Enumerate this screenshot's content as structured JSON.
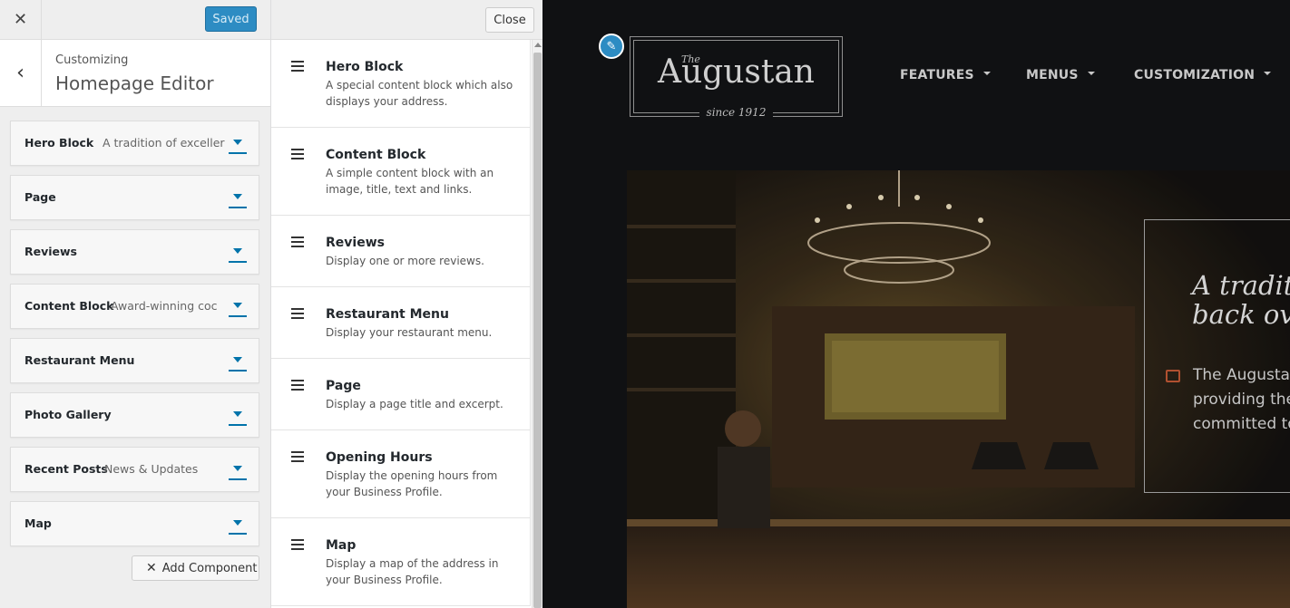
{
  "customizer": {
    "close_icon": "close-icon",
    "saved_label": "Saved",
    "back_icon": "chevron-left-icon",
    "subtitle": "Customizing",
    "title": "Homepage Editor",
    "components": [
      {
        "title": "Hero Block",
        "subtitle": "A tradition of exceller"
      },
      {
        "title": "Page",
        "subtitle": ""
      },
      {
        "title": "Reviews",
        "subtitle": ""
      },
      {
        "title": "Content Block",
        "subtitle": "Award-winning coc"
      },
      {
        "title": "Restaurant Menu",
        "subtitle": ""
      },
      {
        "title": "Photo Gallery",
        "subtitle": ""
      },
      {
        "title": "Recent Posts",
        "subtitle": "News & Updates"
      },
      {
        "title": "Map",
        "subtitle": ""
      }
    ],
    "add_component_label": "Add Component"
  },
  "picker": {
    "close_label": "Close",
    "items": [
      {
        "title": "Hero Block",
        "desc": "A special content block which also displays your address."
      },
      {
        "title": "Content Block",
        "desc": "A simple content block with an image, title, text and links."
      },
      {
        "title": "Reviews",
        "desc": "Display one or more reviews."
      },
      {
        "title": "Restaurant Menu",
        "desc": "Display your restaurant menu."
      },
      {
        "title": "Page",
        "desc": "Display a page title and excerpt."
      },
      {
        "title": "Opening Hours",
        "desc": "Display the opening hours from your Business Profile."
      },
      {
        "title": "Map",
        "desc": "Display a map of the address in your Business Profile."
      }
    ]
  },
  "preview": {
    "logo": {
      "the": "The",
      "name": "Augustan",
      "since": "since 1912"
    },
    "nav": [
      "FEATURES",
      "MENUS",
      "CUSTOMIZATION"
    ],
    "hero_heading": "A traditi\nback ove",
    "hero_text": "The Augusta\nproviding the\ncommitted to"
  },
  "colors": {
    "accent": "#0073aa",
    "saved_button": "#2d8cc3",
    "preview_bg": "#101113"
  }
}
